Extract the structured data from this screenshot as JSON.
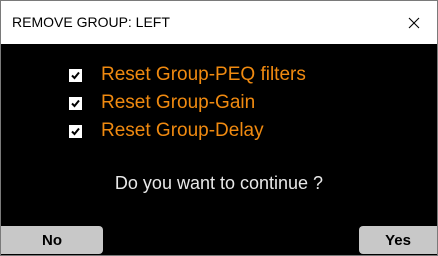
{
  "dialog": {
    "title": "REMOVE GROUP: LEFT",
    "close_icon": "close-icon",
    "options": [
      {
        "label": "Reset Group-PEQ filters",
        "checked": true
      },
      {
        "label": "Reset Group-Gain",
        "checked": true
      },
      {
        "label": "Reset Group-Delay",
        "checked": true
      }
    ],
    "question": "Do you want to continue ?",
    "no_label": "No",
    "yes_label": "Yes",
    "colors": {
      "background": "#000000",
      "option_text": "#f08a10",
      "question_text": "#e8e8e8",
      "button_bg": "#c8c8c8"
    }
  }
}
